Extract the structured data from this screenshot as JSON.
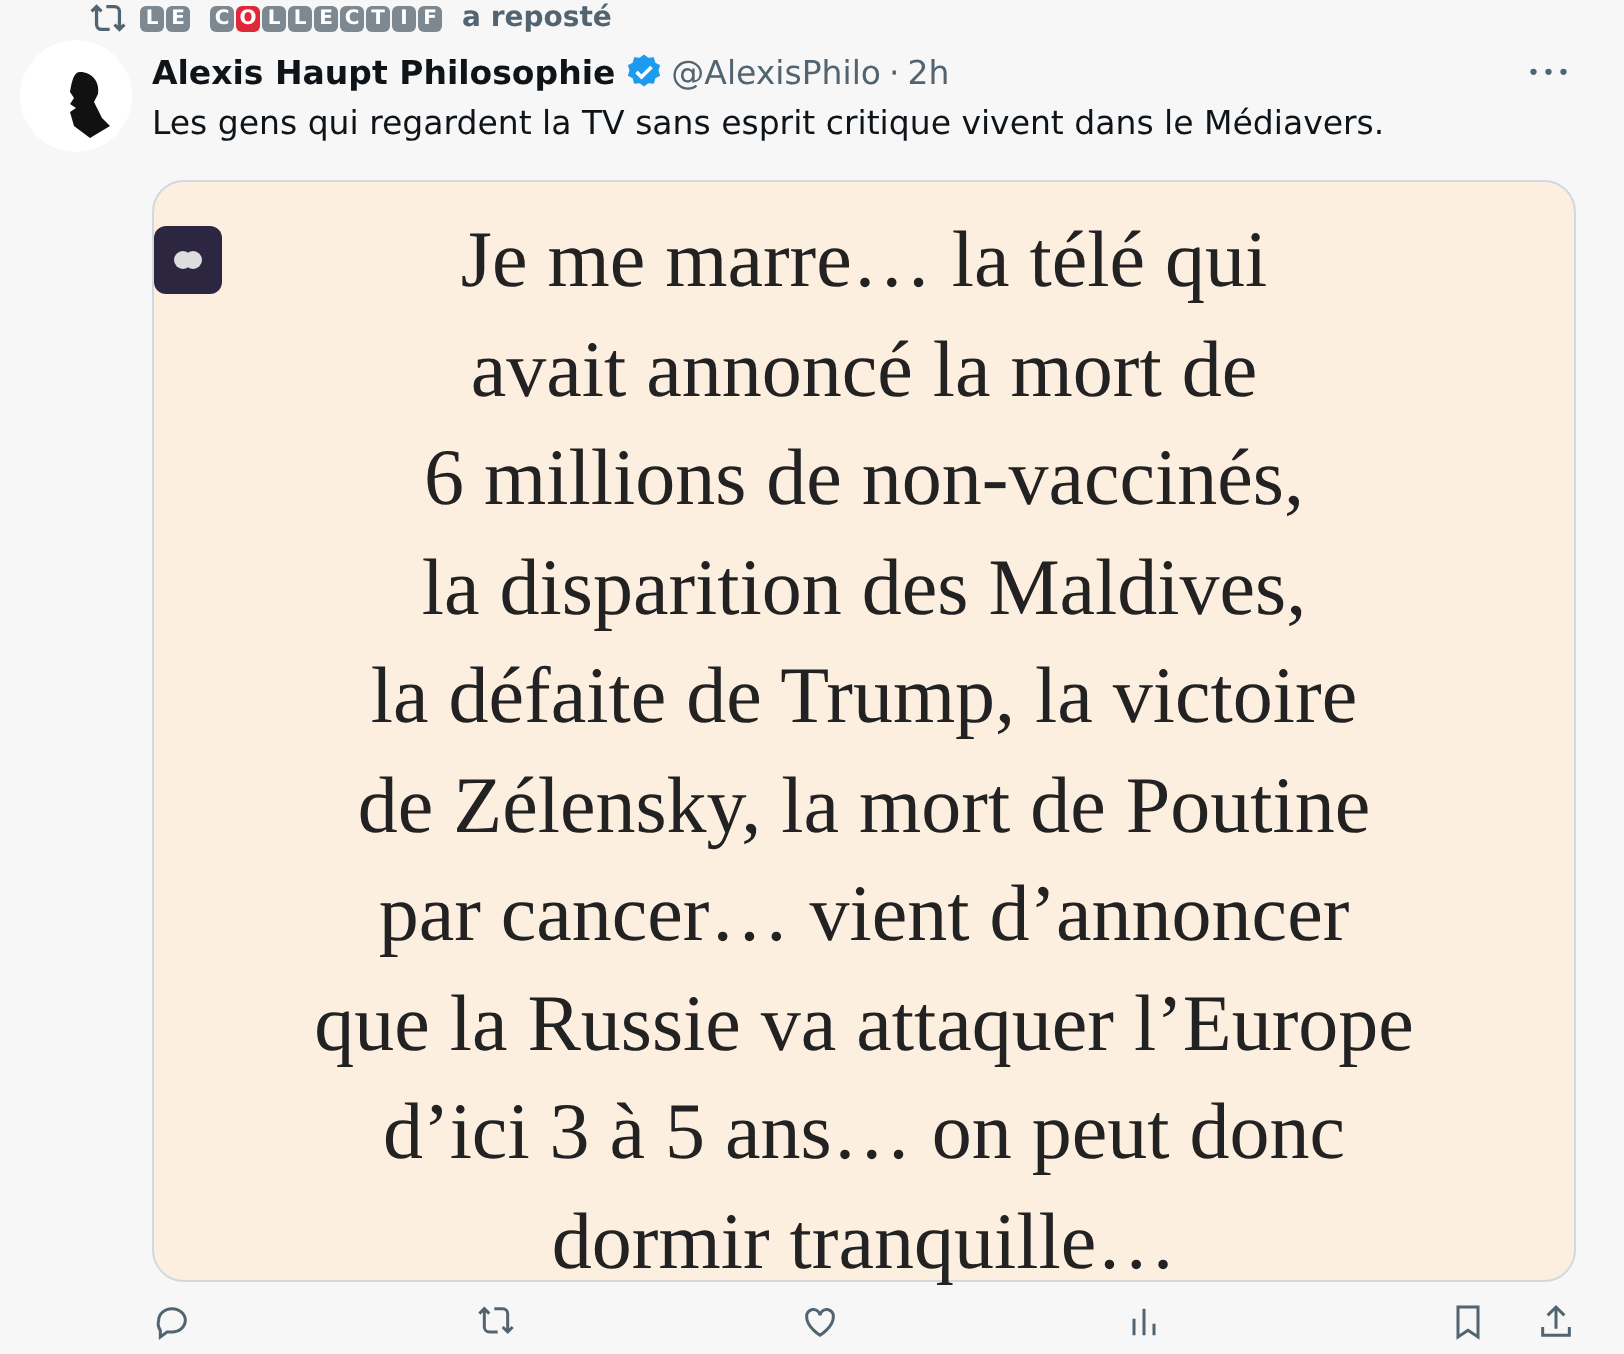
{
  "repost": {
    "words": [
      {
        "letters": [
          {
            "char": "L",
            "highlighted": false
          },
          {
            "char": "E",
            "highlighted": false
          }
        ]
      },
      {
        "letters": [
          {
            "char": "C",
            "highlighted": false
          },
          {
            "char": "O",
            "highlighted": true
          },
          {
            "char": "L",
            "highlighted": false
          },
          {
            "char": "L",
            "highlighted": false
          },
          {
            "char": "E",
            "highlighted": false
          },
          {
            "char": "C",
            "highlighted": false
          },
          {
            "char": "T",
            "highlighted": false
          },
          {
            "char": "I",
            "highlighted": false
          },
          {
            "char": "F",
            "highlighted": false
          }
        ]
      }
    ],
    "suffix": "a reposté"
  },
  "tweet": {
    "author": "Alexis Haupt Philosophie",
    "verified": true,
    "handle": "@AlexisPhilo",
    "separator": "·",
    "time": "2h",
    "more": "•••",
    "text": "Les gens qui regardent la TV sans esprit critique vivent dans le Médiavers.",
    "image_lines": [
      "Je me marre… la télé qui",
      "avait annoncé la mort de",
      "6 millions de non-vaccinés,",
      "la disparition des Maldives,",
      "la défaite de Trump, la victoire",
      "de Zélensky, la mort de Poutine",
      "par cancer… vient d’annoncer",
      "que la Russie va attaquer l’Europe",
      "d’ici 3 à 5 ans… on peut donc",
      "dormir tranquille…"
    ]
  }
}
